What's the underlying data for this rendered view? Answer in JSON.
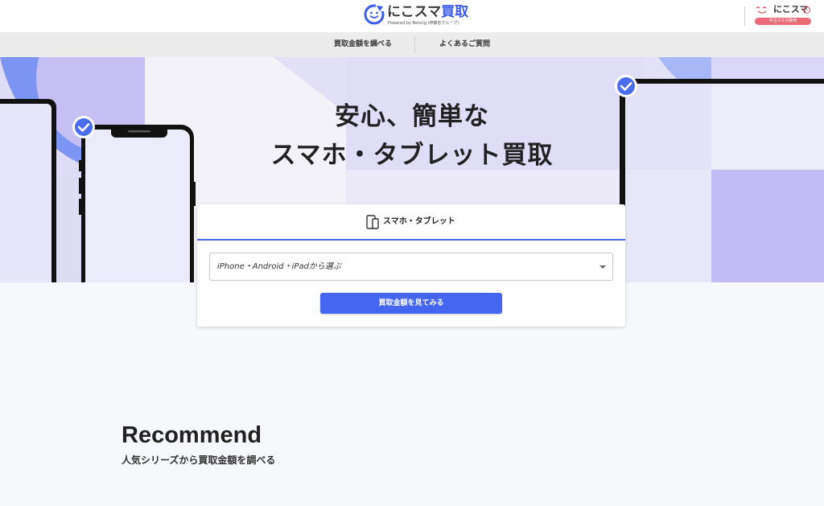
{
  "header": {
    "logo_main": "にこスマ",
    "logo_accent": "買取",
    "logo_sub": "Powered by Belong (伊藤忠グループ)",
    "partner_name": "にこスマ",
    "partner_badge": "中古スマホ販売"
  },
  "subnav": {
    "items": [
      {
        "label": "買取金額を調べる"
      },
      {
        "label": "よくあるご質問"
      }
    ]
  },
  "hero": {
    "title_line1": "安心、簡単な",
    "title_line2": "スマホ・タブレット買取"
  },
  "search_card": {
    "tab_label": "スマホ・タブレット",
    "tab_icon": "phone-tablet-icon",
    "select_value": "iPhone・Android・iPadから選ぶ",
    "cta_label": "買取金額を見てみる"
  },
  "recommend": {
    "title": "Recommend",
    "subtitle": "人気シリーズから買取金額を調べる"
  },
  "colors": {
    "brand_blue": "#4466f1",
    "hero_bg": "#eceaf8",
    "hero_lavender": "#c3bdf4",
    "partner_pink": "#ea6a78"
  }
}
